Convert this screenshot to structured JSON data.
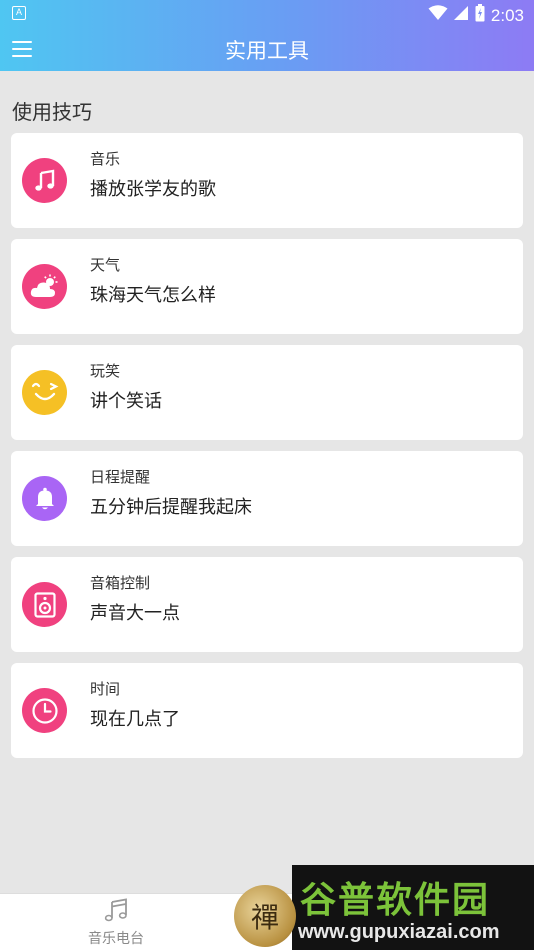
{
  "status_bar": {
    "notification_glyph": "A",
    "time": "2:03",
    "icons": [
      "wifi-icon",
      "signal-icon",
      "battery-icon"
    ]
  },
  "app_bar": {
    "title": "实用工具",
    "menu_icon": "hamburger-menu-icon"
  },
  "section": {
    "title": "使用技巧"
  },
  "cards": [
    {
      "title": "音乐",
      "text": "播放张学友的歌",
      "icon": "music-note-icon",
      "color": "#f0417f"
    },
    {
      "title": "天气",
      "text": "珠海天气怎么样",
      "icon": "weather-cloud-sun-icon",
      "color": "#f0417f"
    },
    {
      "title": "玩笑",
      "text": "讲个笑话",
      "icon": "wink-smile-icon",
      "color": "#f5c025"
    },
    {
      "title": "日程提醒",
      "text": "五分钟后提醒我起床",
      "icon": "bell-icon",
      "color": "#a965f5"
    },
    {
      "title": "音箱控制",
      "text": "声音大一点",
      "icon": "speaker-icon",
      "color": "#f0417f"
    },
    {
      "title": "时间",
      "text": "现在几点了",
      "icon": "clock-icon",
      "color": "#f0417f"
    }
  ],
  "bottom_nav": {
    "items": [
      {
        "label": "音乐电台",
        "icon": "music-notes-icon"
      }
    ]
  },
  "watermark": {
    "badge_text": "禪",
    "title": "谷普软件园",
    "url": "www.gupuxiazai.com"
  }
}
